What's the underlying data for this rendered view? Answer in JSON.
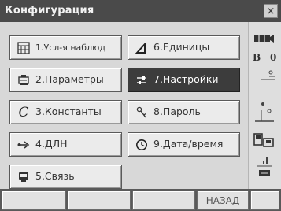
{
  "window": {
    "title": "Конфигурация",
    "close_glyph": "×"
  },
  "menu": [
    {
      "label": "1.Усл-я наблюд",
      "icon": "observation-conditions-icon"
    },
    {
      "label": "2.Параметры",
      "icon": "instrument-parameters-icon"
    },
    {
      "label": "3.Константы",
      "icon": "constants-icon"
    },
    {
      "label": "4.ДЛН",
      "icon": "distance-icon"
    },
    {
      "label": "5.Связь",
      "icon": "communication-icon"
    },
    {
      "label": "6.Единицы",
      "icon": "units-icon"
    },
    {
      "label": "7.Настройки",
      "icon": "settings-icon",
      "selected": true
    },
    {
      "label": "8.Пароль",
      "icon": "password-key-icon"
    },
    {
      "label": "9.Дата/время",
      "icon": "date-time-icon"
    }
  ],
  "status": {
    "sensor_letter": "B",
    "sensor_value": "0"
  },
  "softkeys": [
    "",
    "",
    "",
    "НАЗАД",
    ""
  ],
  "colors": {
    "title_bg": "#4a4a4a",
    "selected_bg": "#3c3c3c",
    "button_bg": "#ebebeb"
  }
}
